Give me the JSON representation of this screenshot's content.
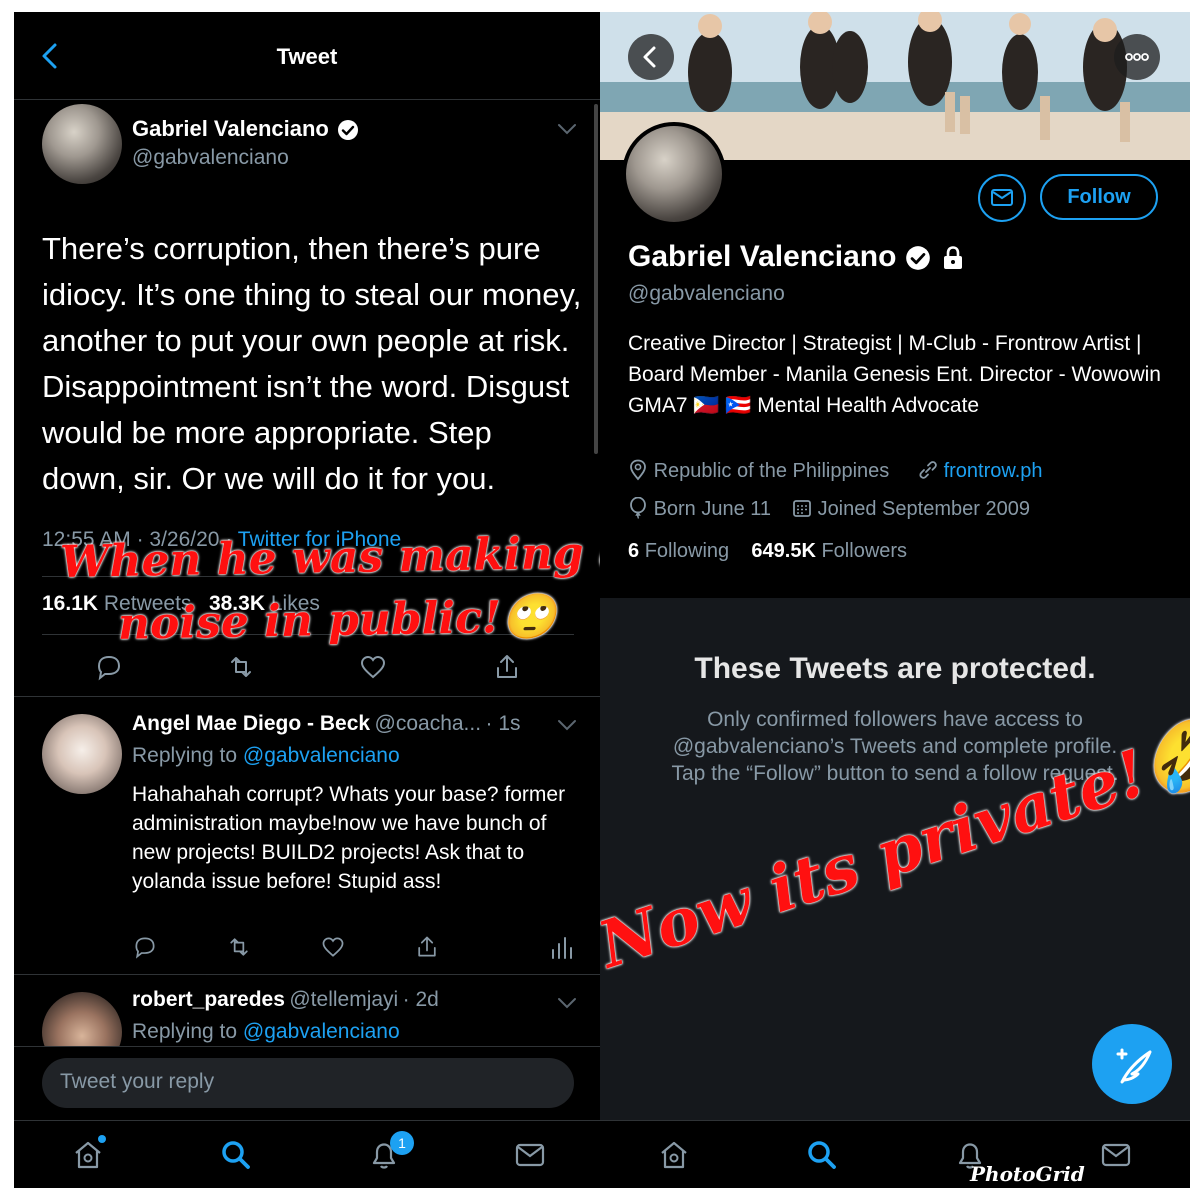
{
  "left": {
    "header": {
      "title": "Tweet"
    },
    "tweet": {
      "author_name": "Gabriel Valenciano",
      "author_handle": "@gabvalenciano",
      "text": "There’s corruption, then there’s pure idiocy. It’s one thing to steal our money, another to put your own people at risk. Disappointment isn’t the word. Disgust would be more appropriate. Step down, sir. Or we will do it for you.",
      "time": "12:55 AM",
      "date": "3/26/20",
      "source": "Twitter for iPhone",
      "retweets_count": "16.1K",
      "retweets_label": "Retweets",
      "likes_count": "38.3K",
      "likes_label": "Likes"
    },
    "replies": [
      {
        "name": "Angel Mae Diego - Beck",
        "handle": "@coacha...",
        "age": "1s",
        "replying_prefix": "Replying to",
        "replying_to": "@gabvalenciano",
        "text": "Hahahahah corrupt? Whats your base? former administration maybe!now we have bunch of new projects! BUILD2 projects! Ask that to yolanda issue before! Stupid ass!"
      },
      {
        "name": "robert_paredes",
        "handle": "@tellemjayi",
        "age": "2d",
        "replying_prefix": "Replying to",
        "replying_to": "@gabvalenciano"
      }
    ],
    "reply_placeholder": "Tweet your reply",
    "notifications_badge": "1"
  },
  "right": {
    "profile": {
      "name": "Gabriel Valenciano",
      "handle": "@gabvalenciano",
      "follow_label": "Follow",
      "bio": "Creative Director | Strategist | M-Club - Frontrow Artist | Board Member - Manila Genesis Ent. Director - Wowowin GMA7 🇵🇭 🇵🇷 Mental Health Advocate",
      "location": "Republic of the Philippines",
      "website": "frontrow.ph",
      "born": "Born June 11",
      "joined": "Joined September 2009",
      "following_count": "6",
      "following_label": "Following",
      "followers_count": "649.5K",
      "followers_label": "Followers"
    },
    "protected": {
      "title": "These Tweets are protected.",
      "body": "Only confirmed followers have access to @gabvalenciano’s Tweets and complete profile. Tap the “Follow” button to send a follow request."
    }
  },
  "overlays": {
    "caption_left_line1": "When he was making a",
    "caption_left_line2": "noise in public!🙄",
    "caption_right": "Now its private!🤣",
    "watermark": "PhotoGrid"
  },
  "colors": {
    "accent": "#1da1f2",
    "background": "#000000",
    "overlay_red": "#ff1010"
  }
}
